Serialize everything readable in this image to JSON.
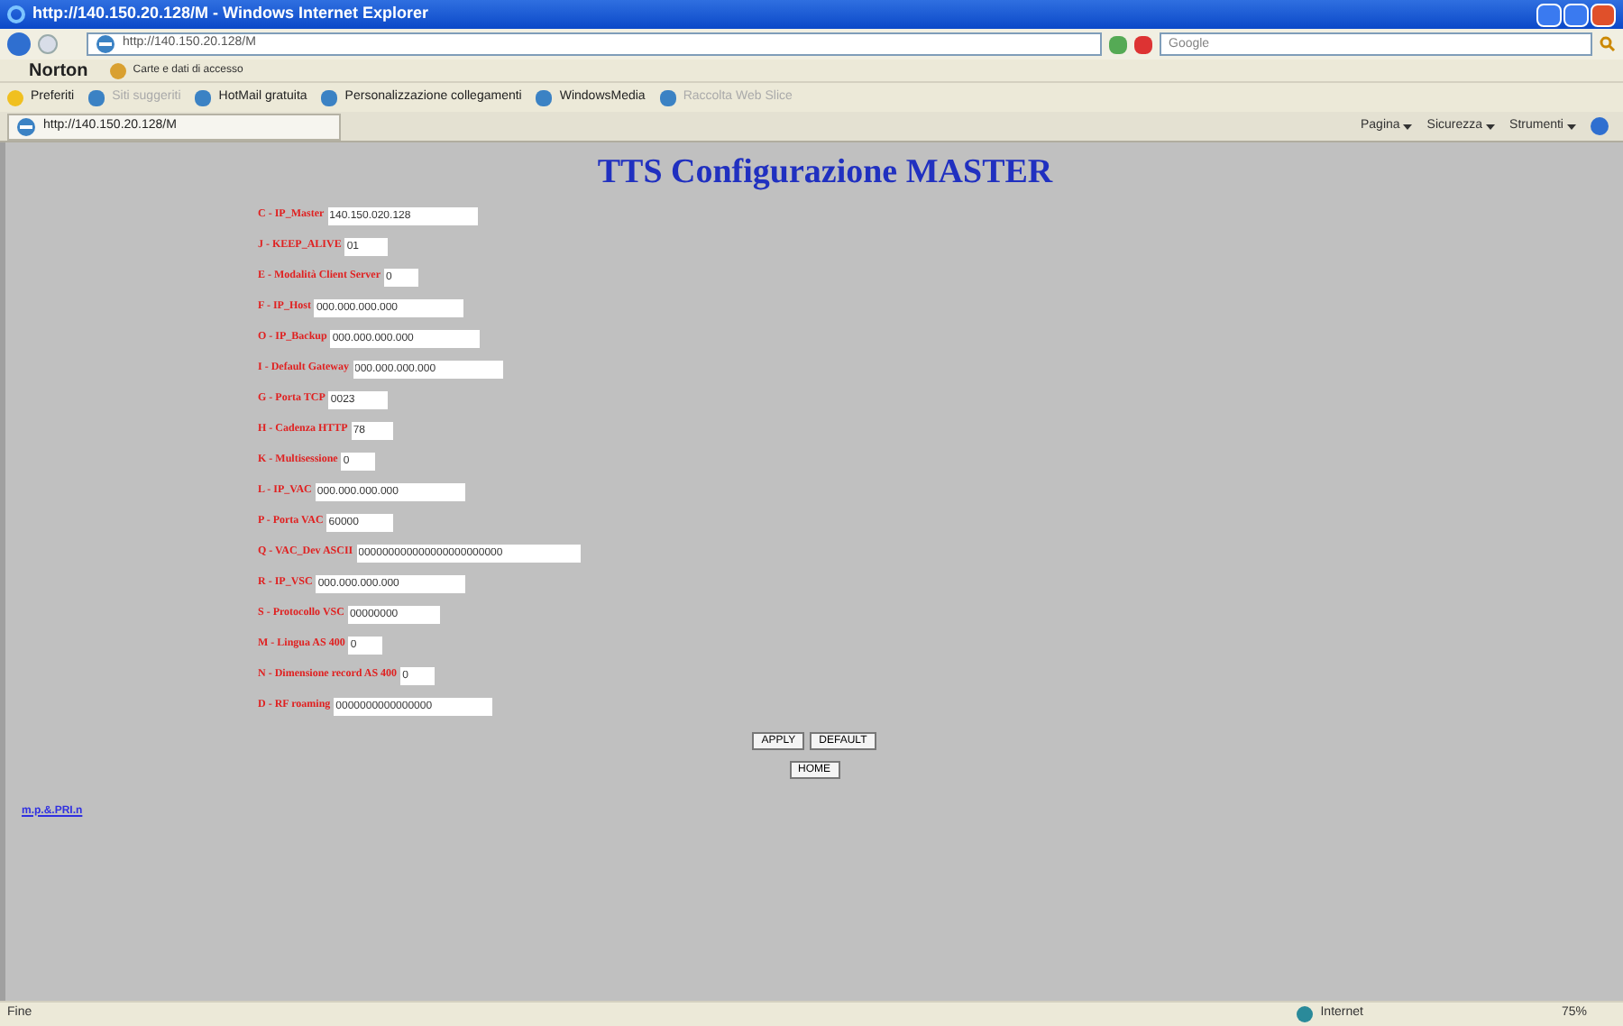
{
  "window": {
    "title": "http://140.150.20.128/M - Windows Internet Explorer"
  },
  "address_bar": {
    "value": "http://140.150.20.128/M",
    "search_placeholder": "Google"
  },
  "norton_bar": {
    "items": [
      "Norton",
      "Carte e dati di accesso"
    ]
  },
  "favorites_bar": {
    "items": [
      "Preferiti",
      "Siti suggeriti",
      "HotMail gratuita",
      "Personalizzazione collegamenti",
      "WindowsMedia",
      "Raccolta Web Slice"
    ]
  },
  "tab": {
    "label": "http://140.150.20.128/M"
  },
  "command_bar": {
    "items": [
      "Pagina",
      "Sicurezza",
      "Strumenti"
    ]
  },
  "page": {
    "title": "TTS Configurazione MASTER",
    "fields": [
      {
        "label": "C - IP_Master",
        "value": "140.150.020.128"
      },
      {
        "label": "J - KEEP_ALIVE",
        "value": "01"
      },
      {
        "label": "E - Modalità Client Server",
        "value": "0"
      },
      {
        "label": "F - IP_Host",
        "value": "000.000.000.000"
      },
      {
        "label": "O - IP_Backup",
        "value": "000.000.000.000"
      },
      {
        "label": "I - Default Gateway",
        "value": "000.000.000.000"
      },
      {
        "label": "G - Porta TCP",
        "value": "0023"
      },
      {
        "label": "H - Cadenza HTTP",
        "value": "78"
      },
      {
        "label": "K - Multisessione",
        "value": "0"
      },
      {
        "label": "L - IP_VAC",
        "value": "000.000.000.000"
      },
      {
        "label": "P - Porta VAC",
        "value": "60000"
      },
      {
        "label": "Q - VAC_Dev ASCII",
        "value": "000000000000000000000000"
      },
      {
        "label": "R - IP_VSC",
        "value": "000.000.000.000"
      },
      {
        "label": "S - Protocollo VSC",
        "value": "00000000"
      },
      {
        "label": "M - Lingua AS 400",
        "value": "0"
      },
      {
        "label": "N - Dimensione record AS 400",
        "value": "0"
      },
      {
        "label": "D - RF roaming",
        "value": "0000000000000000"
      }
    ],
    "buttons": [
      "APPLY",
      "DEFAULT"
    ],
    "home_button": "HOME",
    "link": "m.p.&.PRI.n"
  },
  "status_bar": {
    "text": "Fine",
    "zone": "Internet",
    "zoom": "75%"
  }
}
